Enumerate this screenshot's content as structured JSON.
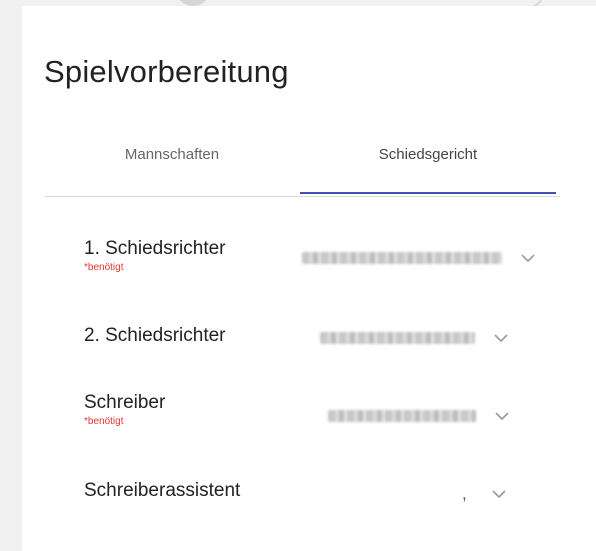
{
  "header": {
    "title": "Spielvorbereitung"
  },
  "tabs": [
    {
      "label": "Mannschaften"
    },
    {
      "label": "Schiedsgericht"
    }
  ],
  "rows": [
    {
      "label": "1. Schiedsrichter",
      "required_note": "*benötigt"
    },
    {
      "label": "2. Schiedsrichter"
    },
    {
      "label": "Schreiber",
      "required_note": "*benötigt"
    },
    {
      "label": "Schreiberassistent",
      "value": ","
    }
  ],
  "colors": {
    "accent": "#3f51b5",
    "required": "#e53935"
  },
  "icons": {
    "select": "chevron-down-icon"
  }
}
